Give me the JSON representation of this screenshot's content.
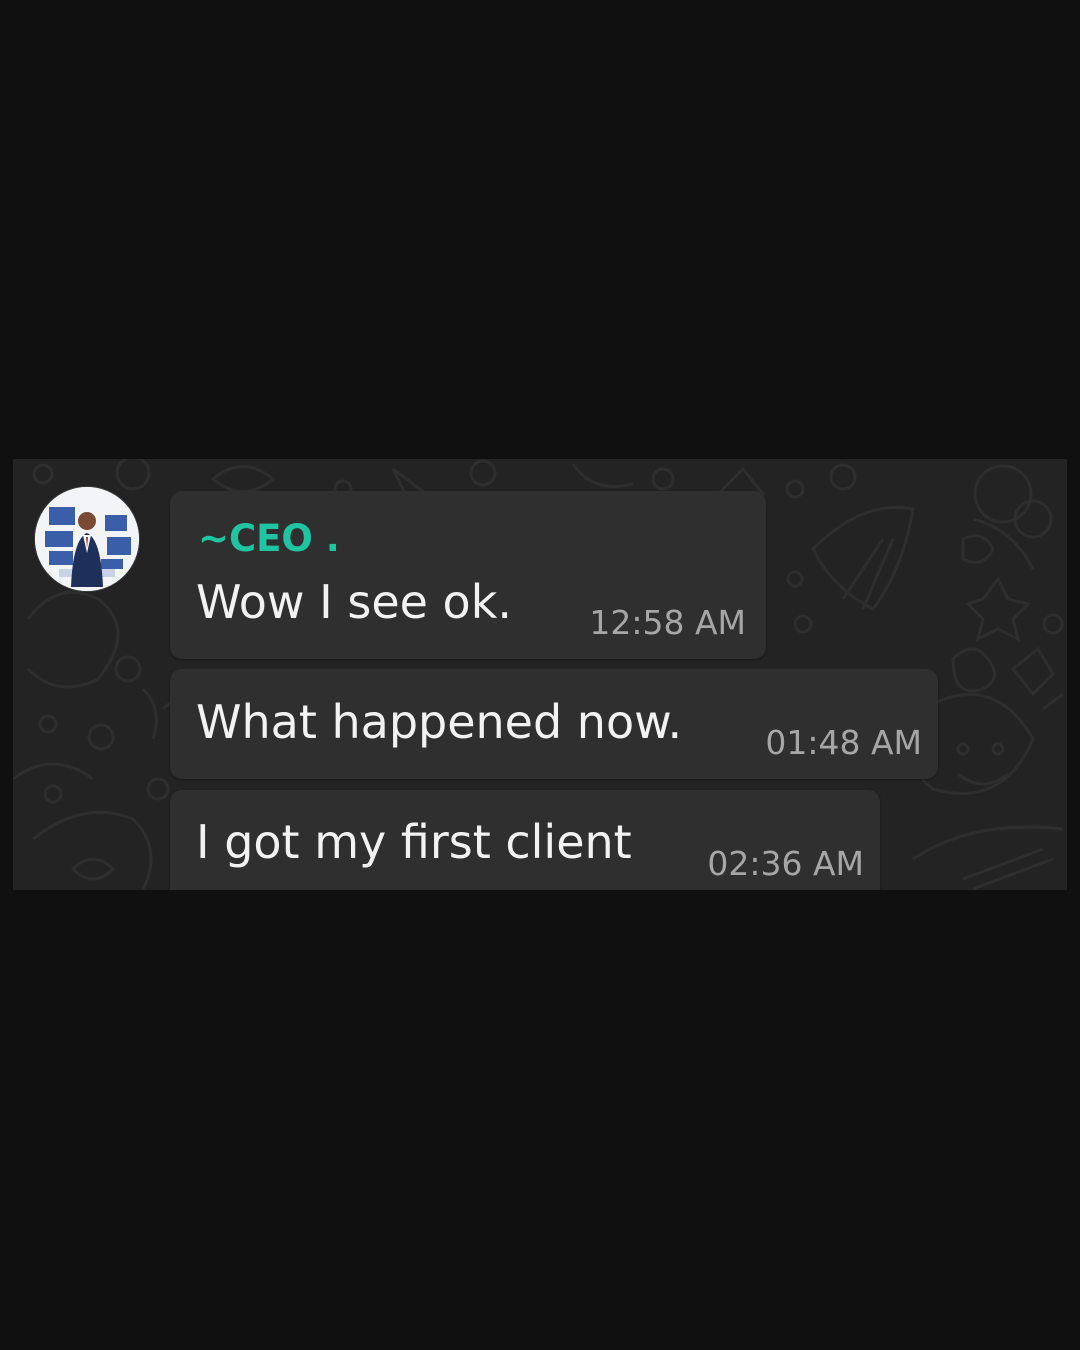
{
  "chat": {
    "sender_name": "~CEO .",
    "sender_color": "#1fc5a2",
    "background_color": "#232323",
    "bubble_color": "#2f2f2f",
    "messages": [
      {
        "text": "Wow I see ok.",
        "time": "12:58 AM"
      },
      {
        "text": "What happened now.",
        "time": "01:48 AM"
      },
      {
        "text": "I got my first client",
        "time": "02:36 AM"
      }
    ]
  }
}
